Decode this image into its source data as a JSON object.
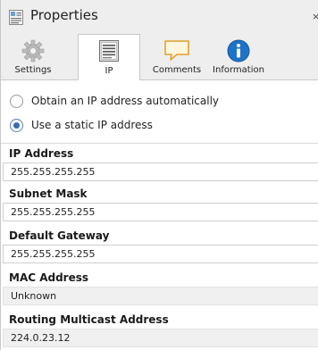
{
  "window": {
    "title": "Properties",
    "title_icon": "properties-icon",
    "close_glyph": "×"
  },
  "tabs": [
    {
      "label": "Settings",
      "icon": "gear-icon",
      "active": false
    },
    {
      "label": "IP",
      "icon": "ip-list-icon",
      "active": true
    },
    {
      "label": "Comments",
      "icon": "comment-icon",
      "active": false
    },
    {
      "label": "Information",
      "icon": "info-icon",
      "active": false
    }
  ],
  "ip_mode": {
    "options": [
      {
        "label": "Obtain an IP address automatically",
        "checked": false
      },
      {
        "label": "Use a static IP address",
        "checked": true
      }
    ]
  },
  "fields": {
    "ip_address": {
      "label": "IP Address",
      "value": "255.255.255.255"
    },
    "subnet_mask": {
      "label": "Subnet Mask",
      "value": "255.255.255.255"
    },
    "default_gateway": {
      "label": "Default Gateway",
      "value": "255.255.255.255"
    },
    "mac_address": {
      "label": "MAC Address",
      "value": "Unknown"
    },
    "routing_multicast": {
      "label": "Routing Multicast Address",
      "value": "224.0.23.12"
    }
  },
  "colors": {
    "accent": "#3b6cb4",
    "info_blue": "#1e73c8",
    "tab_bg": "#eeeeee"
  }
}
